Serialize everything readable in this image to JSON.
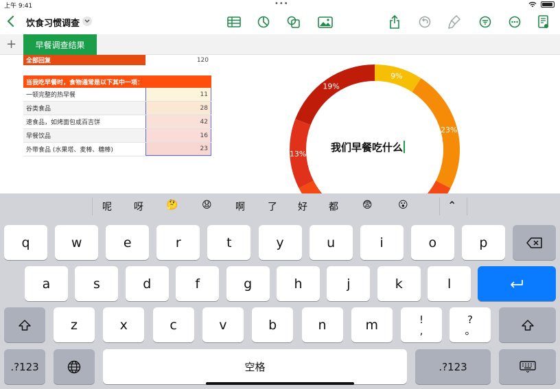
{
  "status": {
    "time": "上午 9:41",
    "dots": "•••"
  },
  "toolbar": {
    "title": "饮食习惯调查",
    "icons": [
      "table-icon",
      "chart-icon",
      "shapes-icon",
      "media-icon",
      "share-icon",
      "undo-icon",
      "format-brush-icon",
      "filter-icon",
      "more-icon",
      "doc-options-icon"
    ]
  },
  "sheet_bar": {
    "add": "+",
    "active_tab": "早餐调查结果"
  },
  "table1": {
    "label": "全部回复",
    "value": "120"
  },
  "table2": {
    "header": "当我吃早餐时，食物通常是以下其中一项：",
    "rows": [
      {
        "label": "一顿完整的热早餐",
        "value": "11",
        "fill": "#fdf4dc"
      },
      {
        "label": "谷类食品",
        "value": "28",
        "fill": "#fbe8d4"
      },
      {
        "label": "速食品，如烤面包或百吉饼",
        "value": "42",
        "fill": "#f9e0d8"
      },
      {
        "label": "早餐饮品",
        "value": "16",
        "fill": "#f9dcd8"
      },
      {
        "label": "外带食品 (水果塔、麦棒、糖棒)",
        "value": "23",
        "fill": "#f8d6d2"
      }
    ]
  },
  "chart_data": {
    "type": "pie",
    "style": "donut",
    "title": "我们早餐吃什么",
    "categories": [
      "一顿完整的热早餐",
      "谷类食品",
      "速食品，如烤面包或百吉饼",
      "早餐饮品",
      "外带食品 (水果塔、麦棒、糖棒)"
    ],
    "values": [
      11,
      28,
      42,
      16,
      23
    ],
    "colors": [
      "#f6bf06",
      "#f58b06",
      "#f24a12",
      "#e0321a",
      "#c01c0a"
    ],
    "visible_percent_labels": [
      {
        "index": 0,
        "text": "9%"
      },
      {
        "index": 1,
        "text": "23%"
      },
      {
        "index": 3,
        "text": "13%"
      },
      {
        "index": 4,
        "text": "19%"
      }
    ]
  },
  "keyboard": {
    "candidates": [
      "呢",
      "呀",
      "🤔",
      "😧",
      "啊",
      "了",
      "好",
      "都",
      "😨",
      "😮"
    ],
    "collapse": "⌃",
    "row1": [
      "q",
      "w",
      "e",
      "r",
      "t",
      "y",
      "u",
      "i",
      "o",
      "p"
    ],
    "row2": [
      "a",
      "s",
      "d",
      "f",
      "g",
      "h",
      "j",
      "k",
      "l"
    ],
    "row3": [
      "z",
      "x",
      "c",
      "v",
      "b",
      "n",
      "m"
    ],
    "punct1_top": "!",
    "punct1_bottom": ",",
    "punct2_top": "?",
    "punct2_bottom": "。",
    "numbers_label": ".?123",
    "space_label": "空格"
  }
}
